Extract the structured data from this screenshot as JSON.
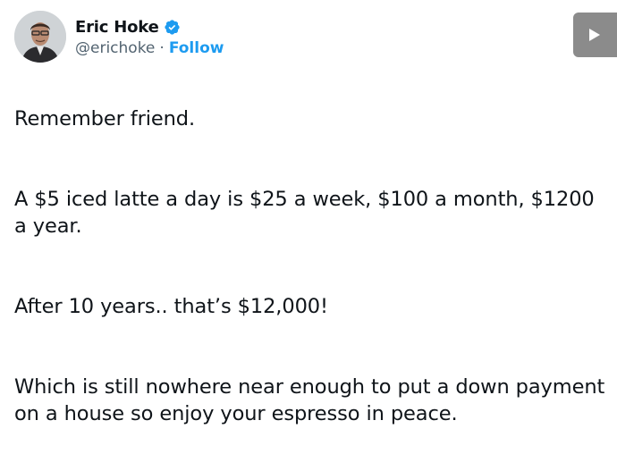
{
  "tweet": {
    "display_name": "Eric Hoke",
    "handle": "@erichoke",
    "separator": "·",
    "follow_label": "Follow",
    "verified_icon": "verified-badge-icon",
    "avatar_icon": "user-avatar",
    "play_icon": "play-icon",
    "paragraphs": [
      "Remember friend.",
      "A $5 iced latte a day is $25 a week, $100 a month, $1200 a year.",
      "After 10 years.. that’s $12,000!",
      "Which is still nowhere near enough to put a down payment on a house so enjoy your espresso in peace."
    ]
  },
  "colors": {
    "text": "#0f1419",
    "secondary": "#536471",
    "accent": "#1d9bf0",
    "media_button": "#8b8b8b"
  }
}
